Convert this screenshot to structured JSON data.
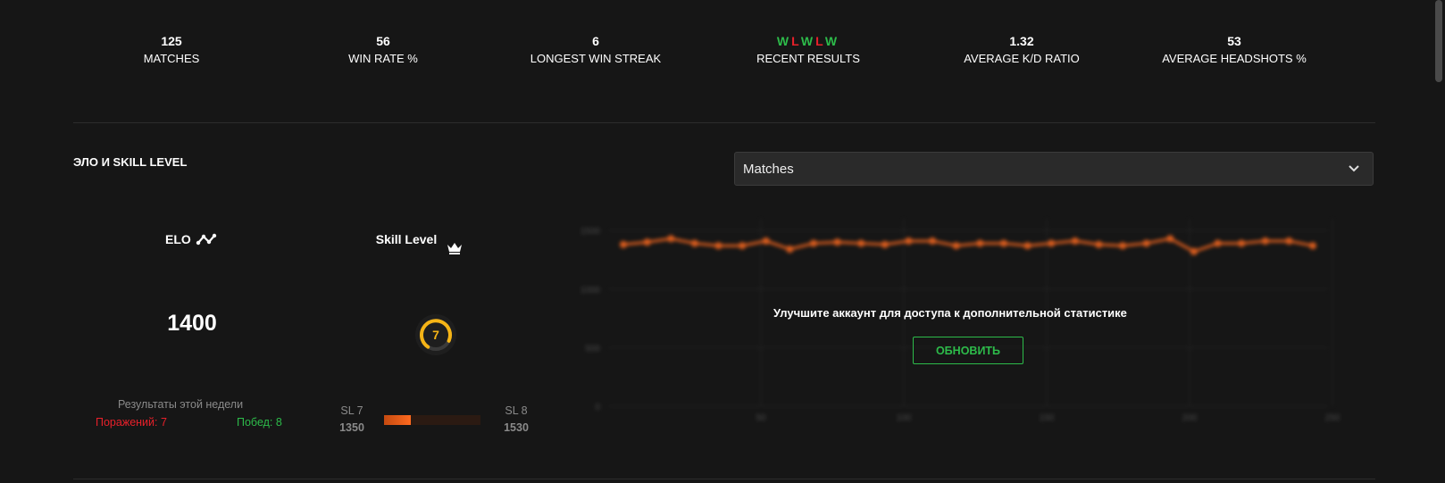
{
  "stats": [
    {
      "value": "125",
      "label": "MATCHES"
    },
    {
      "value": "56",
      "label": "WIN RATE %"
    },
    {
      "value": "6",
      "label": "LONGEST WIN STREAK"
    },
    {
      "value": "",
      "label": "RECENT RESULTS"
    },
    {
      "value": "1.32",
      "label": "AVERAGE K/D RATIO"
    },
    {
      "value": "53",
      "label": "AVERAGE HEADSHOTS %"
    }
  ],
  "recent_results": [
    "W",
    "L",
    "W",
    "L",
    "W"
  ],
  "section": {
    "title": "ЭЛО И SKILL LEVEL"
  },
  "select": {
    "value": "Matches",
    "icon": "chevron-down-icon"
  },
  "elo": {
    "label": "ELO",
    "value": "1400",
    "icon": "elo-trend-icon"
  },
  "skill": {
    "label": "Skill Level",
    "level": "7",
    "icon": "crown-icon",
    "color": "#f5b416"
  },
  "week": {
    "title": "Результаты этой недели",
    "losses": "Поражений: 7",
    "wins": "Побед: 8"
  },
  "progress": {
    "left_name": "SL 7",
    "left_value": "1350",
    "right_name": "SL 8",
    "right_value": "1530",
    "fraction": 0.28
  },
  "overlay": {
    "message": "Улучшите аккаунт для доступа к дополнительной статистике",
    "button": "ОБНОВИТЬ"
  },
  "colors": {
    "accent": "#ff6a1f",
    "win": "#2dbb4a",
    "loss": "#e8202a",
    "background": "#161616"
  },
  "chart_data": {
    "type": "line",
    "y_ticks": [
      "1500",
      "1000",
      "500",
      "0"
    ],
    "x_ticks": [
      "50",
      "100",
      "150",
      "200",
      "250"
    ],
    "ylim": [
      0,
      1600
    ],
    "series": [
      {
        "values": [
          1380,
          1400,
          1430,
          1390,
          1370,
          1370,
          1410,
          1340,
          1390,
          1400,
          1390,
          1380,
          1410,
          1410,
          1370,
          1390,
          1390,
          1370,
          1390,
          1410,
          1380,
          1370,
          1390,
          1430,
          1320,
          1390,
          1390,
          1410,
          1410,
          1370
        ]
      }
    ]
  }
}
